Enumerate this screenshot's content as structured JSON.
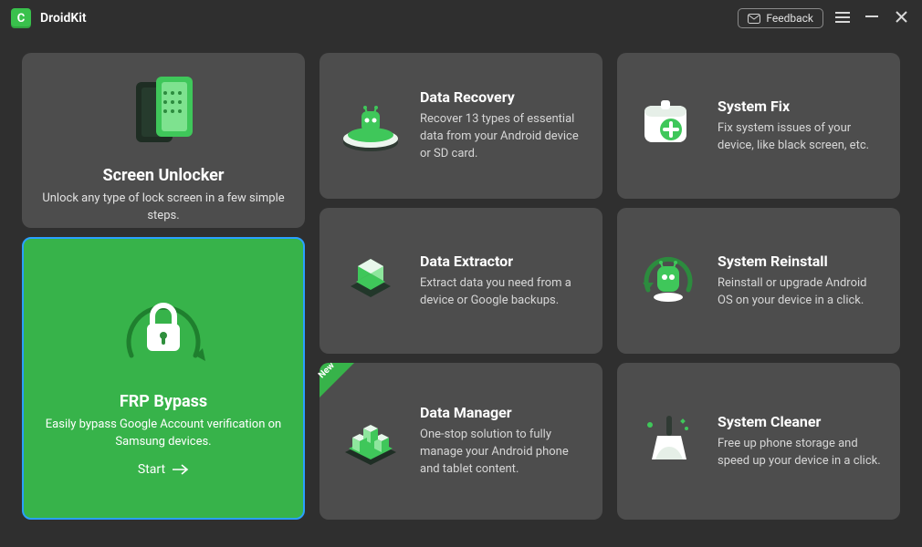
{
  "app": {
    "logo_letter": "C",
    "title": "DroidKit"
  },
  "titlebar": {
    "feedback_label": "Feedback"
  },
  "cards": {
    "screen_unlocker": {
      "title": "Screen Unlocker",
      "desc": "Unlock any type of lock screen in a few simple steps."
    },
    "frp_bypass": {
      "title": "FRP Bypass",
      "desc": "Easily bypass Google Account verification on Samsung devices.",
      "start_label": "Start"
    },
    "data_recovery": {
      "title": "Data Recovery",
      "desc": "Recover 13 types of essential data from your Android device or SD card."
    },
    "system_fix": {
      "title": "System Fix",
      "desc": "Fix system issues of your device, like black screen, etc."
    },
    "data_extractor": {
      "title": "Data Extractor",
      "desc": "Extract data you need from a device or Google backups."
    },
    "system_reinstall": {
      "title": "System Reinstall",
      "desc": "Reinstall or upgrade Android OS on your device in a click."
    },
    "data_manager": {
      "title": "Data Manager",
      "desc": "One-stop solution to fully manage your Android phone and tablet content.",
      "badge": "New"
    },
    "system_cleaner": {
      "title": "System Cleaner",
      "desc": "Free up phone storage and speed up your device in a click."
    }
  }
}
